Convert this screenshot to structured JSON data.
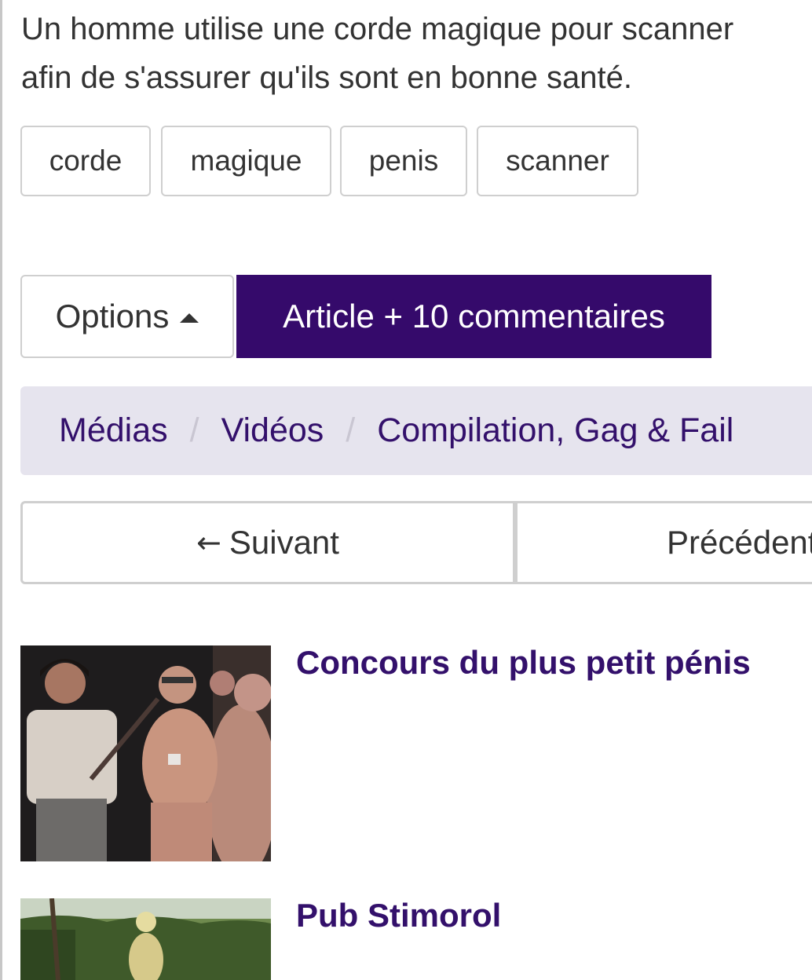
{
  "description": {
    "line1": "Un homme utilise une corde magique pour scanner",
    "line2": "afin de s'assurer qu'ils sont en bonne santé."
  },
  "tags": [
    "corde",
    "magique",
    "penis",
    "scanner"
  ],
  "actions": {
    "options_label": "Options",
    "article_label": "Article + 10 commentaires",
    "article_bg": "#350a6b"
  },
  "breadcrumb": [
    "Médias",
    "Vidéos",
    "Compilation, Gag & Fail"
  ],
  "breadcrumb_separator": "/",
  "pager": {
    "next_label": "Suivant",
    "prev_label": "Précédent"
  },
  "related": [
    {
      "title": "Concours du plus petit pénis",
      "thumb_icon": "video-thumbnail"
    },
    {
      "title": "Pub Stimorol",
      "thumb_icon": "video-thumbnail"
    }
  ],
  "colors": {
    "link": "#33106b",
    "breadcrumb_bg": "#e6e4ee",
    "border": "#cfcfcf"
  }
}
